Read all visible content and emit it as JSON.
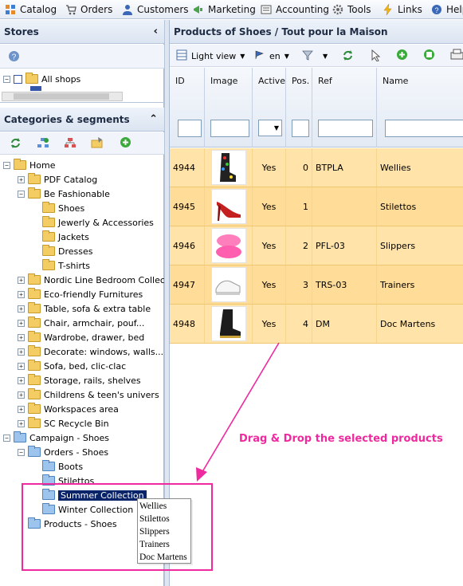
{
  "menu": {
    "items": [
      {
        "label": "Catalog",
        "icon": "catalog-icon"
      },
      {
        "label": "Orders",
        "icon": "cart-icon"
      },
      {
        "label": "Customers",
        "icon": "customers-icon"
      },
      {
        "label": "Marketing",
        "icon": "marketing-icon"
      },
      {
        "label": "Accounting",
        "icon": "accounting-icon"
      },
      {
        "label": "Tools",
        "icon": "gear-icon"
      },
      {
        "label": "Links",
        "icon": "lightning-icon"
      },
      {
        "label": "Help",
        "icon": "help-icon"
      }
    ]
  },
  "stores": {
    "title": "Stores",
    "collapse_glyph": "‹",
    "items": [
      "All shops"
    ]
  },
  "categories": {
    "title": "Categories & segments",
    "collapse_glyph": "⌃",
    "tree": [
      {
        "label": "Home",
        "level": 0,
        "exp": "−",
        "folder": "yellow"
      },
      {
        "label": "PDF Catalog",
        "level": 1,
        "exp": "+",
        "folder": "yellow"
      },
      {
        "label": "Be Fashionable",
        "level": 1,
        "exp": "−",
        "folder": "yellow"
      },
      {
        "label": "Shoes",
        "level": 2,
        "exp": "",
        "folder": "yellow"
      },
      {
        "label": "Jewerly & Accessories",
        "level": 2,
        "exp": "",
        "folder": "yellow"
      },
      {
        "label": "Jackets",
        "level": 2,
        "exp": "",
        "folder": "yellow"
      },
      {
        "label": "Dresses",
        "level": 2,
        "exp": "",
        "folder": "yellow"
      },
      {
        "label": "T-shirts",
        "level": 2,
        "exp": "",
        "folder": "yellow"
      },
      {
        "label": "Nordic Line Bedroom Collection",
        "level": 1,
        "exp": "+",
        "folder": "yellow"
      },
      {
        "label": "Eco-friendly Furnitures",
        "level": 1,
        "exp": "+",
        "folder": "yellow"
      },
      {
        "label": "Table, sofa & extra table",
        "level": 1,
        "exp": "+",
        "folder": "yellow"
      },
      {
        "label": "Chair, armchair, pouf...",
        "level": 1,
        "exp": "+",
        "folder": "yellow"
      },
      {
        "label": "Wardrobe, drawer, bed",
        "level": 1,
        "exp": "+",
        "folder": "yellow"
      },
      {
        "label": "Decorate: windows, walls...",
        "level": 1,
        "exp": "+",
        "folder": "yellow"
      },
      {
        "label": "Sofa, bed, clic-clac",
        "level": 1,
        "exp": "+",
        "folder": "yellow"
      },
      {
        "label": "Storage, rails, shelves",
        "level": 1,
        "exp": "+",
        "folder": "yellow"
      },
      {
        "label": "Childrens & teen's univers",
        "level": 1,
        "exp": "+",
        "folder": "yellow"
      },
      {
        "label": "Workspaces area",
        "level": 1,
        "exp": "+",
        "folder": "yellow"
      },
      {
        "label": "SC Recycle Bin",
        "level": 1,
        "exp": "+",
        "folder": "yellow"
      },
      {
        "label": "Campaign - Shoes",
        "level": 0,
        "exp": "−",
        "folder": "blue"
      },
      {
        "label": "Orders - Shoes",
        "level": 1,
        "exp": "−",
        "folder": "blue"
      },
      {
        "label": "Boots",
        "level": 2,
        "exp": "",
        "folder": "blue"
      },
      {
        "label": "Stilettos",
        "level": 2,
        "exp": "",
        "folder": "blue"
      },
      {
        "label": "Summer Collection",
        "level": 2,
        "exp": "",
        "folder": "blue",
        "selected": true
      },
      {
        "label": "Winter Collection",
        "level": 2,
        "exp": "",
        "folder": "blue"
      },
      {
        "label": "Products - Shoes",
        "level": 1,
        "exp": "",
        "folder": "blue"
      }
    ]
  },
  "products": {
    "title": "Products of Shoes / Tout pour la Maison",
    "toolbar": {
      "view_label": "Light view",
      "lang": "en"
    },
    "columns": [
      "ID",
      "Image",
      "Active",
      "Pos.",
      "Ref",
      "Name"
    ],
    "filter_select_glyph": "▼",
    "rows": [
      {
        "id": "4944",
        "image": "wellies-image",
        "active": "Yes",
        "pos": "0",
        "ref": "BTPLA",
        "name": "Wellies"
      },
      {
        "id": "4945",
        "image": "stilettos-image",
        "active": "Yes",
        "pos": "1",
        "ref": "",
        "name": "Stilettos"
      },
      {
        "id": "4946",
        "image": "slippers-image",
        "active": "Yes",
        "pos": "2",
        "ref": "PFL-03",
        "name": "Slippers"
      },
      {
        "id": "4947",
        "image": "trainers-image",
        "active": "Yes",
        "pos": "3",
        "ref": "TRS-03",
        "name": "Trainers"
      },
      {
        "id": "4948",
        "image": "doc-martens-image",
        "active": "Yes",
        "pos": "4",
        "ref": "DM",
        "name": "Doc Martens"
      }
    ]
  },
  "annotation": {
    "text": "Drag & Drop the selected products",
    "color": "#ee2a9e"
  },
  "drag_list": [
    "Wellies",
    "Stilettos",
    "Slippers",
    "Trainers",
    "Doc Martens"
  ]
}
